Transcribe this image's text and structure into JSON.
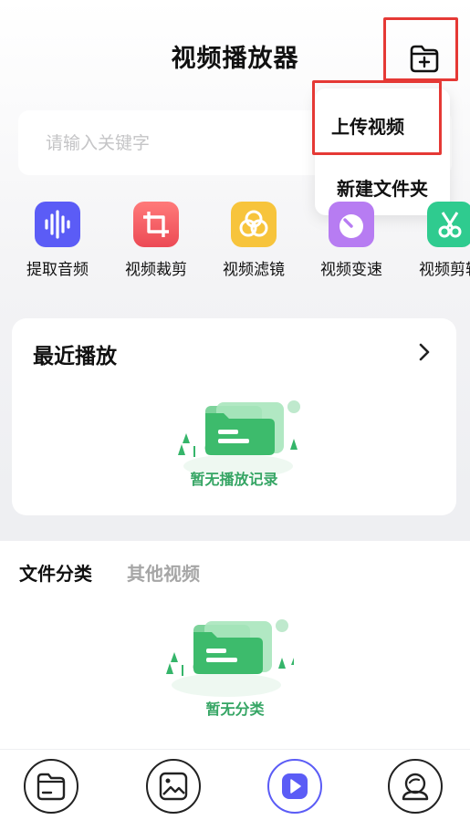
{
  "header": {
    "title": "视频播放器",
    "add_icon": "folder-plus-icon"
  },
  "search": {
    "placeholder": "请输入关键字",
    "value": ""
  },
  "popup_menu": {
    "items": [
      "上传视频",
      "新建文件夹"
    ]
  },
  "tools": [
    {
      "label": "提取音频",
      "icon": "audio-wave-icon",
      "color": "#5b5cf6"
    },
    {
      "label": "视频裁剪",
      "icon": "crop-icon",
      "color": "#f0555c"
    },
    {
      "label": "视频滤镜",
      "icon": "filter-icon",
      "color": "#f7c43c"
    },
    {
      "label": "视频变速",
      "icon": "speed-gauge-icon",
      "color": "#b77cf2"
    },
    {
      "label": "视频剪辑",
      "icon": "scissors-icon",
      "color": "#2fcb8f"
    }
  ],
  "recent": {
    "title": "最近播放",
    "empty_text": "暂无播放记录"
  },
  "categories": {
    "tabs": [
      "文件分类",
      "其他视频"
    ],
    "active_tab": 0,
    "empty_text": "暂无分类"
  },
  "nav": {
    "items": [
      {
        "icon": "folder-icon"
      },
      {
        "icon": "image-icon"
      },
      {
        "icon": "play-icon",
        "active": true
      },
      {
        "icon": "profile-icon"
      }
    ]
  },
  "colors": {
    "accent": "#5b5cf6",
    "highlight": "#e53935",
    "empty_green": "#35a564"
  }
}
